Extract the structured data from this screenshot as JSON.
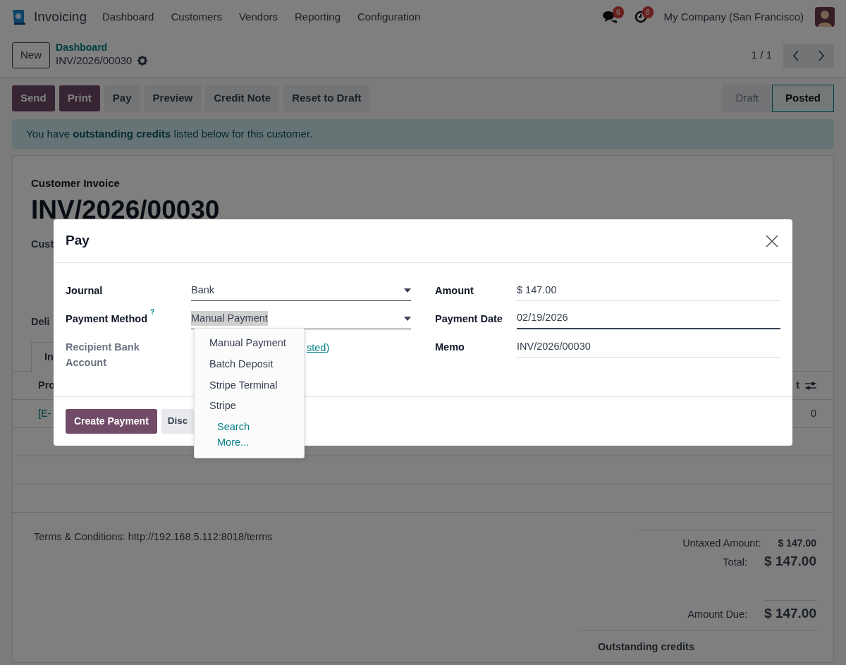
{
  "navbar": {
    "app": "Invoicing",
    "menu": [
      "Dashboard",
      "Customers",
      "Vendors",
      "Reporting",
      "Configuration"
    ],
    "messages_badge": "6",
    "activities_badge": "8",
    "company": "My Company (San Francisco)"
  },
  "control_panel": {
    "new_button": "New",
    "breadcrumb": "Dashboard",
    "record": "INV/2026/00030",
    "pager": "1 / 1"
  },
  "actions": [
    {
      "label": "Send",
      "kind": "primary"
    },
    {
      "label": "Print",
      "kind": "primary"
    },
    {
      "label": "Pay",
      "kind": "secondary"
    },
    {
      "label": "Preview",
      "kind": "secondary"
    },
    {
      "label": "Credit Note",
      "kind": "secondary"
    },
    {
      "label": "Reset to Draft",
      "kind": "secondary"
    }
  ],
  "status_bar": [
    {
      "label": "Draft",
      "selected": false
    },
    {
      "label": "Posted",
      "selected": true
    }
  ],
  "alert": "You have **outstanding credits** listed below for this customer.",
  "sheet": {
    "type_label": "Customer Invoice",
    "title": "INV/2026/00030",
    "field_labels": [
      "Cust",
      "Deli"
    ],
    "tab": "In",
    "table": {
      "header": [
        "Pro",
        "t"
      ],
      "row": [
        "[E-",
        "0"
      ]
    },
    "terms": "Terms & Conditions: http://192.168.5.112:8018/terms",
    "totals": [
      {
        "label": "Untaxed Amount:",
        "value": "$ 147.00",
        "kind": "sub"
      },
      {
        "label": "Total:",
        "value": "$ 147.00",
        "kind": "total"
      },
      {
        "label": "Amount Due:",
        "value": "$ 147.00",
        "kind": "due"
      }
    ],
    "outstanding_title": "Outstanding credits"
  },
  "dialog": {
    "title": "Pay",
    "left_fields": [
      {
        "label": "Journal",
        "value": "Bank",
        "kind": "select",
        "highlighted": false,
        "muted": false
      },
      {
        "label": "Payment Method",
        "help": "?",
        "value": "Manual Payment",
        "kind": "select",
        "highlighted": true,
        "muted": false
      },
      {
        "label": "Recipient Bank Account",
        "value": "sted)",
        "kind": "link",
        "highlighted": false,
        "muted": true
      }
    ],
    "right_fields": [
      {
        "label": "Amount",
        "value": "$ 147.00",
        "focused": false
      },
      {
        "label": "Payment Date",
        "value": "02/19/2026",
        "focused": true
      },
      {
        "label": "Memo",
        "value": "INV/2026/00030",
        "focused": false
      }
    ],
    "buttons": [
      {
        "label": "Create Payment",
        "kind": "primary"
      },
      {
        "label": "Disc",
        "kind": "secondary"
      }
    ],
    "dropdown": {
      "options": [
        "Manual Payment",
        "Batch Deposit",
        "Stripe Terminal",
        "Stripe"
      ],
      "search_more": "Search More..."
    }
  }
}
